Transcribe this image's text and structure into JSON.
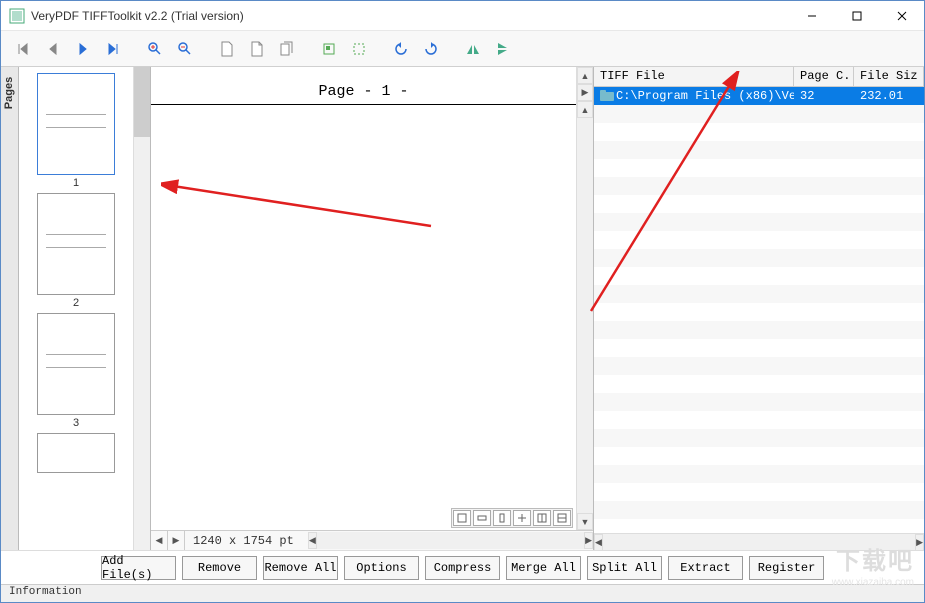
{
  "window": {
    "title": "VeryPDF TIFFToolkit v2.2 (Trial version)"
  },
  "pages_tab": {
    "label": "Pages"
  },
  "thumbs": [
    {
      "label": "1",
      "selected": true
    },
    {
      "label": "2",
      "selected": false
    },
    {
      "label": "3",
      "selected": false
    }
  ],
  "preview": {
    "page_header": "Page - 1 -",
    "dimensions": "1240 x 1754 pt"
  },
  "file_table": {
    "columns": {
      "file": "TIFF File",
      "pages": "Page C...",
      "size": "File Siz"
    },
    "rows": [
      {
        "path": "C:\\Program Files (x86)\\Ver...",
        "pages": "32",
        "size": "232.01",
        "selected": true
      }
    ],
    "stripe_rows": 24
  },
  "buttons": {
    "add": "Add File(s)",
    "remove": "Remove",
    "remove_all": "Remove All",
    "options": "Options",
    "compress": "Compress",
    "merge": "Merge All",
    "split": "Split All",
    "extract": "Extract",
    "register": "Register"
  },
  "status": {
    "label": "Information"
  },
  "watermark": {
    "main": "下载吧",
    "sub": "www.xiazaiba.com"
  }
}
